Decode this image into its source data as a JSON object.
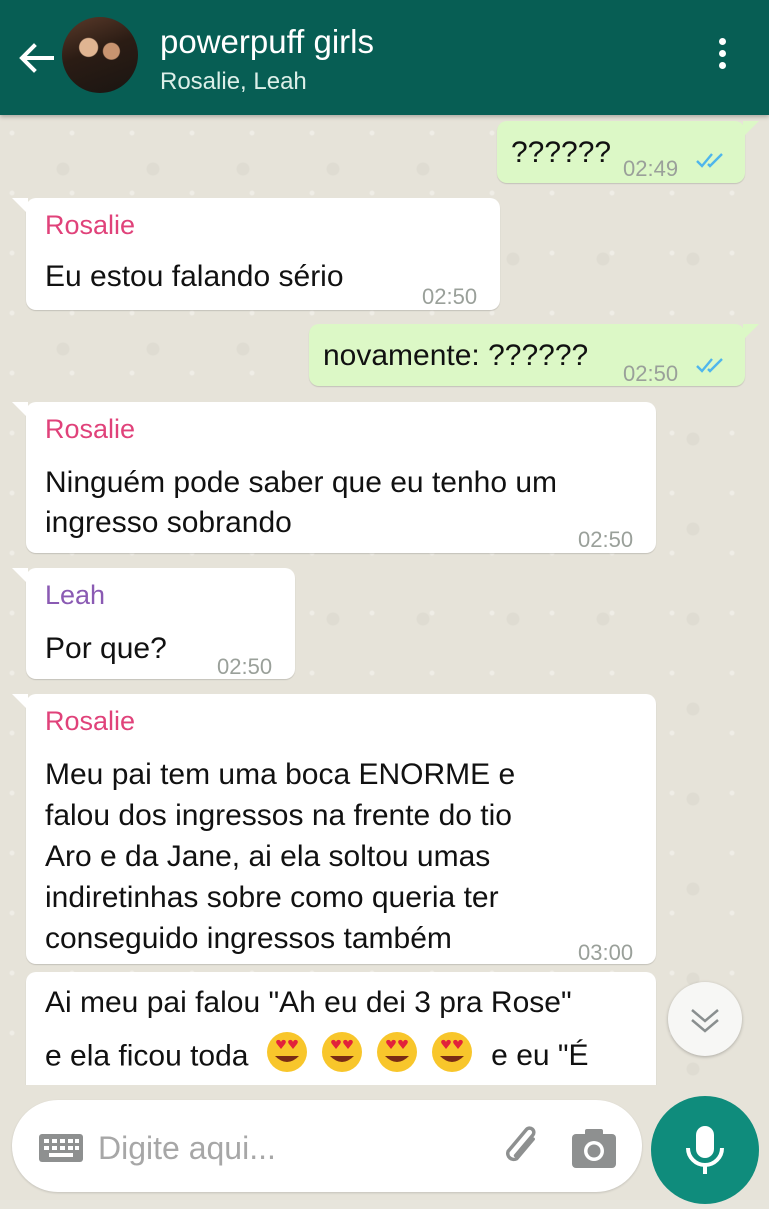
{
  "header": {
    "title": "powerpuff girls",
    "subtitle": "Rosalie, Leah"
  },
  "messages": [
    {
      "direction": "out",
      "text": "??????",
      "time": "02:49",
      "status": "read"
    },
    {
      "direction": "in",
      "sender": "Rosalie",
      "text": "Eu estou falando sério",
      "time": "02:50"
    },
    {
      "direction": "out",
      "text": "novamente: ??????",
      "time": "02:50",
      "status": "read"
    },
    {
      "direction": "in",
      "sender": "Rosalie",
      "lines": [
        "Ninguém pode saber que eu tenho um",
        "ingresso sobrando"
      ],
      "time": "02:50"
    },
    {
      "direction": "in",
      "sender": "Leah",
      "text": "Por que?",
      "time": "02:50"
    },
    {
      "direction": "in",
      "sender": "Rosalie",
      "lines": [
        "Meu pai tem uma boca ENORME e",
        "falou dos ingressos na frente do tio",
        "Aro e da Jane, ai ela soltou umas",
        "indiretinhas sobre como queria ter",
        "conseguido ingressos também"
      ],
      "time": "03:00"
    },
    {
      "direction": "in",
      "lines": [
        "Ai meu pai falou \"Ah eu dei 3 pra Rose\"",
        "e ela ficou toda",
        "e eu \"É"
      ]
    }
  ],
  "composer": {
    "placeholder": "Digite aqui..."
  },
  "colors": {
    "header_bg": "#075e54",
    "outgoing_bubble": "#dcf8c6",
    "incoming_bubble": "#ffffff",
    "sender_rosalie": "#e0427a",
    "sender_leah": "#8a5ab3",
    "read_ticks": "#4fb6ec",
    "mic_button": "#0f8c7c"
  },
  "icons": {
    "back": "arrow-left-icon",
    "menu": "more-vertical-icon",
    "keyboard": "keyboard-icon",
    "attach": "paperclip-icon",
    "camera": "camera-icon",
    "mic": "microphone-icon",
    "scroll_down": "chevron-double-down-icon",
    "emoji": "heart-eyes-emoji"
  }
}
